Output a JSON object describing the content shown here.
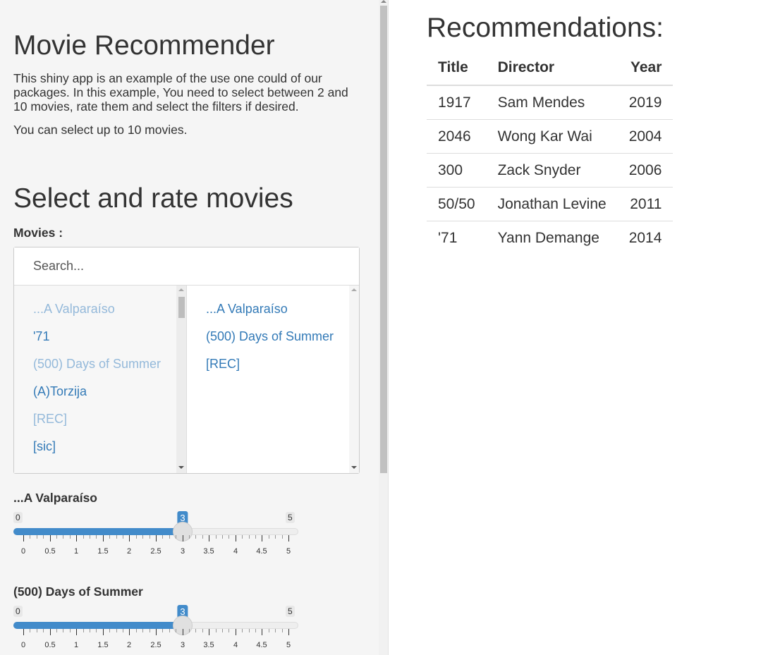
{
  "sidebar": {
    "app_title": "Movie Recommender",
    "intro_1": "This shiny app is an example of the use one could of our packages. In this example, You need to select between 2 and 10 movies, rate them and select the filters if desired.",
    "intro_2": "You can select up to 10 movies.",
    "section_title": "Select and rate movies",
    "movies_label": "Movies :",
    "search_placeholder": "Search...",
    "available_movies": [
      {
        "title": "...A Valparaíso",
        "selected": true
      },
      {
        "title": "'71",
        "selected": false
      },
      {
        "title": "(500) Days of Summer",
        "selected": true
      },
      {
        "title": "(A)Torzija",
        "selected": false
      },
      {
        "title": "[REC]",
        "selected": true
      },
      {
        "title": "[sic]",
        "selected": false
      }
    ],
    "selected_movies": [
      "...A Valparaíso",
      "(500) Days of Summer",
      "[REC]"
    ],
    "ratings": [
      {
        "movie": "...A Valparaíso",
        "min": 0,
        "max": 5,
        "value": 3
      },
      {
        "movie": "(500) Days of Summer",
        "min": 0,
        "max": 5,
        "value": 3
      }
    ],
    "tick_labels": [
      "0",
      "0.5",
      "1",
      "1.5",
      "2",
      "2.5",
      "3",
      "3.5",
      "4",
      "4.5",
      "5"
    ]
  },
  "main": {
    "title": "Recommendations:",
    "columns": [
      "Title",
      "Director",
      "Year"
    ],
    "rows": [
      [
        "1917",
        "Sam Mendes",
        "2019"
      ],
      [
        "2046",
        "Wong Kar Wai",
        "2004"
      ],
      [
        "300",
        "Zack Snyder",
        "2006"
      ],
      [
        "50/50",
        "Jonathan Levine",
        "2011"
      ],
      [
        "'71",
        "Yann Demange",
        "2014"
      ]
    ]
  },
  "colors": {
    "accent": "#428bca",
    "link": "#337ab7",
    "link_selected": "#94b9da"
  }
}
